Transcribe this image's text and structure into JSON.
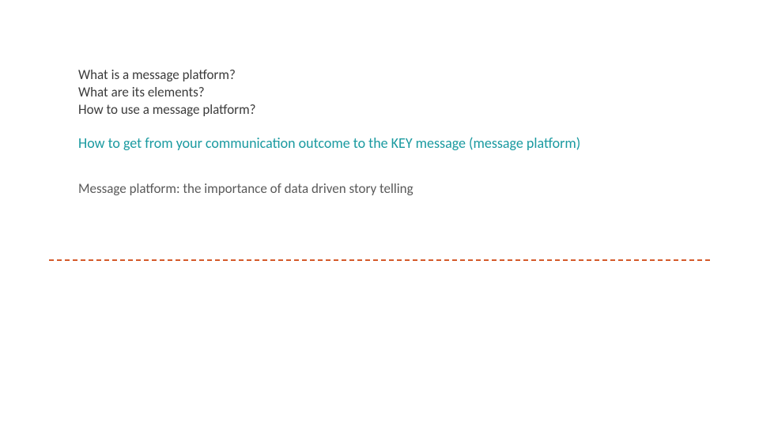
{
  "intro": {
    "line1": "What is a message platform?",
    "line2": "What are its elements?",
    "line3": "How to use a message platform?"
  },
  "highlight": {
    "text": "How to get from your communication outcome to the KEY message (message platform)"
  },
  "sub": {
    "text": "Message platform: the importance of data driven story telling"
  },
  "colors": {
    "teal": "#1a9aa0",
    "orange": "#d45a2a",
    "body": "#3b3b3b",
    "muted": "#595959"
  }
}
